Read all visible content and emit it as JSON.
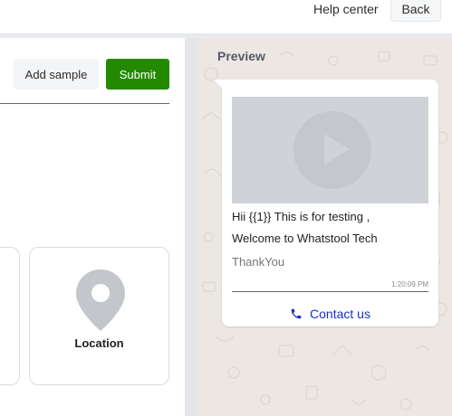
{
  "header": {
    "help_label": "Help center",
    "back_label": "Back"
  },
  "actions": {
    "add_sample_label": "Add sample",
    "submit_label": "Submit"
  },
  "media_options": [
    {
      "label": "Location",
      "icon": "location-pin-icon"
    }
  ],
  "preview": {
    "title": "Preview",
    "media_icon": "play-icon",
    "body_line1": "Hii {{1}} This is for testing ,",
    "body_line2": "Welcome to Whatstool Tech",
    "footer": "ThankYou",
    "time": "1:20:09 PM",
    "button_label": "Contact us",
    "button_icon": "phone-icon"
  },
  "colors": {
    "submit": "#238a00",
    "link": "#1a2fd0",
    "preview_bg": "#ece7e3"
  }
}
